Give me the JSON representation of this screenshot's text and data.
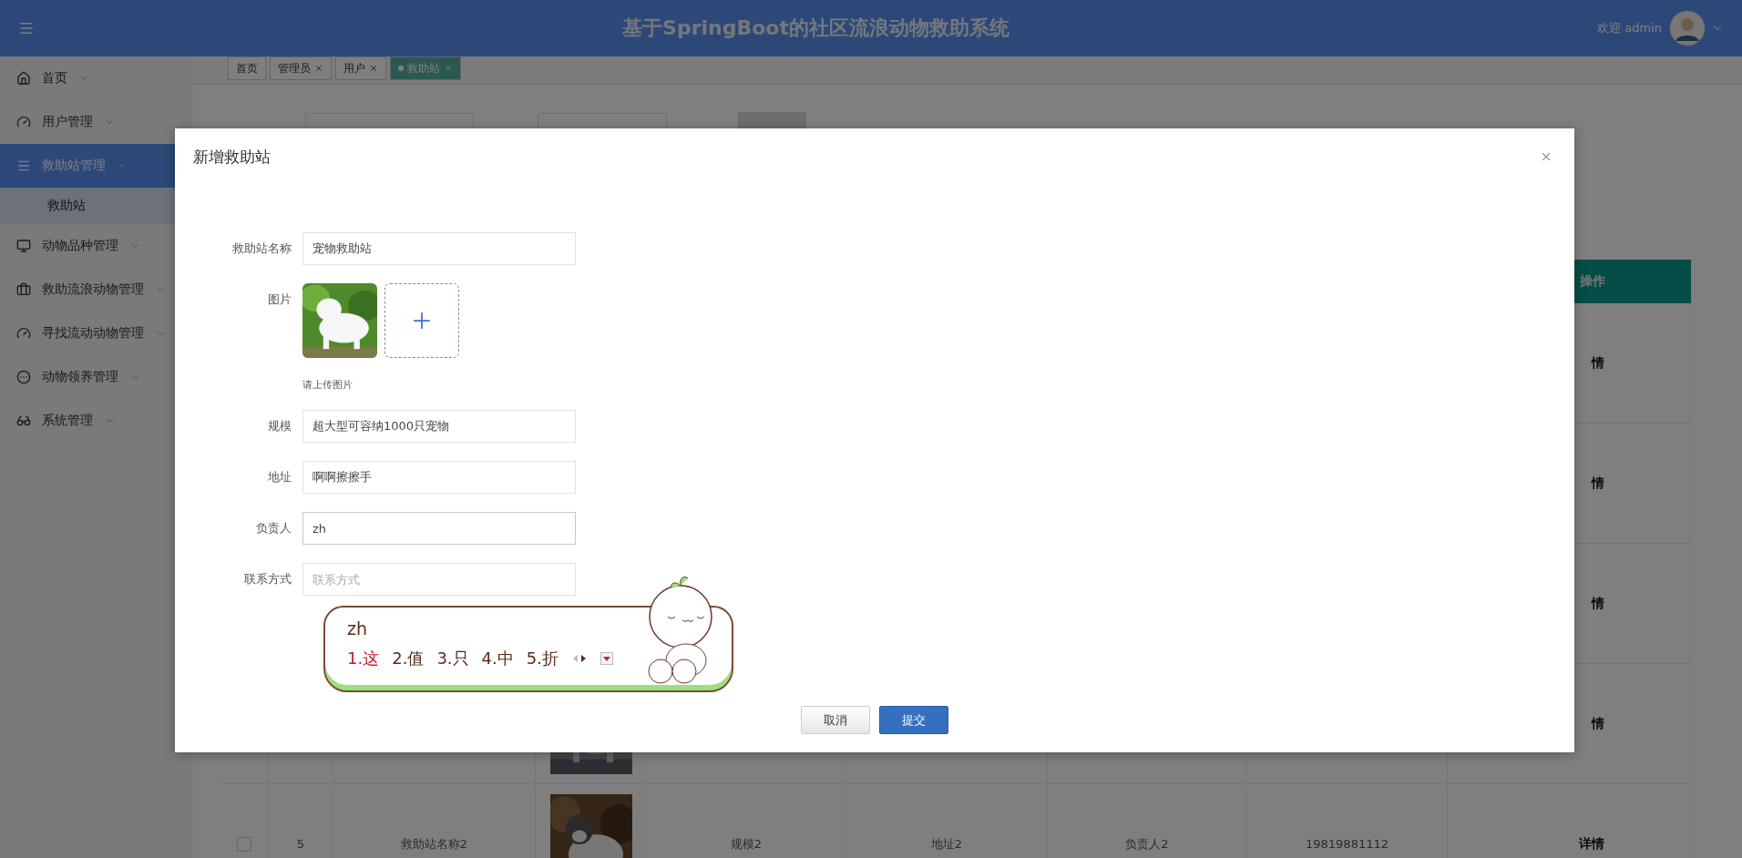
{
  "header": {
    "title": "基于SpringBoot的社区流浪动物救助系统",
    "welcome": "欢迎 admin"
  },
  "sidebar": {
    "items": [
      {
        "label": "首页",
        "expanded": false,
        "selected": false
      },
      {
        "label": "用户管理",
        "expanded": false,
        "selected": false
      },
      {
        "label": "救助站管理",
        "expanded": true,
        "selected": true,
        "children": [
          {
            "label": "救助站",
            "selected": true
          }
        ]
      },
      {
        "label": "动物品种管理",
        "expanded": false,
        "selected": false
      },
      {
        "label": "救助流浪动物管理",
        "expanded": false,
        "selected": false
      },
      {
        "label": "寻找流动动物管理",
        "expanded": false,
        "selected": false
      },
      {
        "label": "动物领养管理",
        "expanded": false,
        "selected": false
      },
      {
        "label": "系统管理",
        "expanded": false,
        "selected": false
      }
    ]
  },
  "tabs": [
    {
      "label": "首页",
      "selected": false,
      "closable": false
    },
    {
      "label": "管理员",
      "selected": false,
      "closable": true
    },
    {
      "label": "用户",
      "selected": false,
      "closable": true
    },
    {
      "label": "救助站",
      "selected": true,
      "closable": true
    }
  ],
  "table": {
    "columns": [
      {
        "label": "操作"
      }
    ],
    "rows": [
      {
        "action": "情"
      },
      {
        "action": "情"
      },
      {
        "action": "情"
      },
      {
        "action": "情"
      },
      {
        "checked": false,
        "index": "5",
        "name": "救助站名称2",
        "scale": "规模2",
        "address": "地址2",
        "manager": "负责人2",
        "contact": "19819881112",
        "action": "详情"
      }
    ]
  },
  "dialog": {
    "title": "新增救助站",
    "fields": [
      {
        "kind": "text",
        "label": "救助站名称",
        "value": "宠物救助站"
      },
      {
        "label": "图片",
        "hint": "请上传图片"
      },
      {
        "kind": "text",
        "label": "规模",
        "value": "超大型可容纳1000只宠物"
      },
      {
        "kind": "text",
        "label": "地址",
        "value": "啊啊擦擦手"
      },
      {
        "kind": "text",
        "label": "负责人",
        "value": "zh",
        "focused": true
      },
      {
        "kind": "text",
        "label": "联系方式",
        "placeholder": "联系方式"
      }
    ],
    "buttons": [
      {
        "label": "取消",
        "primary": false
      },
      {
        "label": "提交",
        "primary": true
      }
    ]
  },
  "ime": {
    "composition": "zh",
    "candidates": [
      {
        "label": "1.这",
        "selected": true
      },
      {
        "label": "2.值",
        "selected": false
      },
      {
        "label": "3.只",
        "selected": false
      },
      {
        "label": "4.中",
        "selected": false
      },
      {
        "label": "5.折",
        "selected": false
      }
    ]
  }
}
